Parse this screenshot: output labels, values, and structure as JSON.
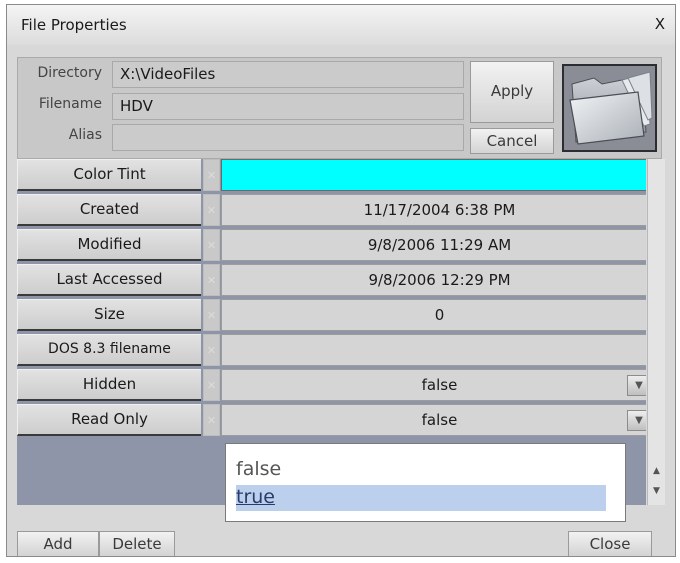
{
  "window": {
    "title": "File Properties",
    "close_glyph": "X"
  },
  "header": {
    "directory_label": "Directory",
    "directory_value": "X:\\VideoFiles",
    "filename_label": "Filename",
    "filename_value": "HDV",
    "alias_label": "Alias",
    "alias_value": "",
    "apply_label": "Apply",
    "cancel_label": "Cancel",
    "preview_icon": "folder-icon"
  },
  "properties": [
    {
      "label": "Color Tint",
      "value": "",
      "swatch": "#00ffff"
    },
    {
      "label": "Created",
      "value": "11/17/2004 6:38 PM"
    },
    {
      "label": "Modified",
      "value": "9/8/2006 11:29 AM"
    },
    {
      "label": "Last Accessed",
      "value": "9/8/2006 12:29 PM"
    },
    {
      "label": "Size",
      "value": "0"
    },
    {
      "label": "DOS 8.3 filename",
      "value": ""
    },
    {
      "label": "Hidden",
      "value": "false",
      "dropdown": true
    },
    {
      "label": "Read Only",
      "value": "false",
      "dropdown": true
    }
  ],
  "dropdown_popup": {
    "options": [
      "false",
      "true"
    ],
    "highlighted": "true"
  },
  "footer": {
    "add_label": "Add",
    "delete_label": "Delete",
    "close_label": "Close"
  },
  "colors": {
    "grid_background": "#8e95a8",
    "highlight": "#bcd0ee"
  }
}
